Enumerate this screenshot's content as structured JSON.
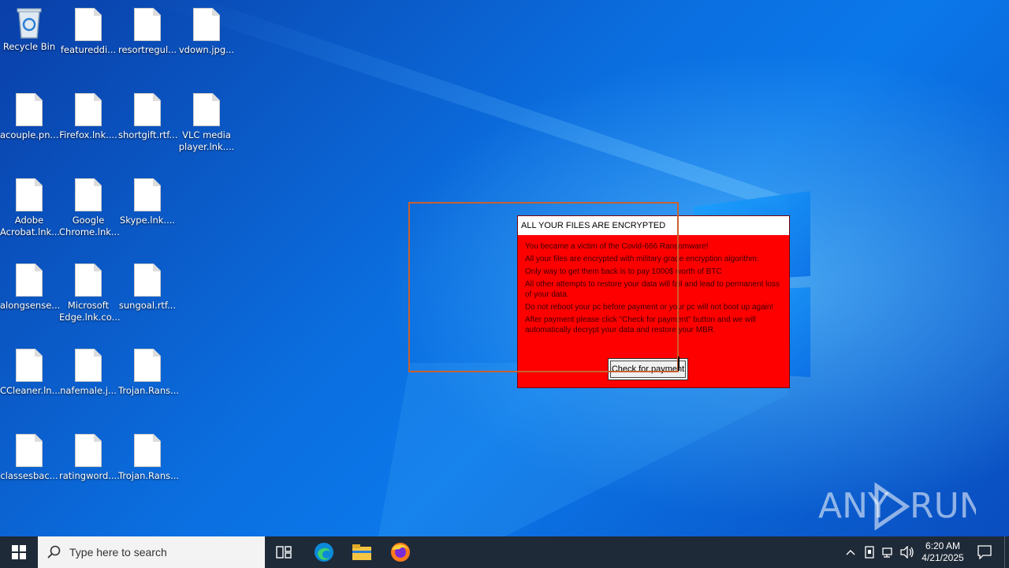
{
  "desktop": {
    "icons": [
      {
        "label": "Recycle Bin",
        "icon": "recycle-bin-icon"
      },
      {
        "label": "featureddi...",
        "icon": "file-icon"
      },
      {
        "label": "resortregul...",
        "icon": "file-icon"
      },
      {
        "label": "vdown.jpg...",
        "icon": "file-icon"
      },
      {
        "label": "acouple.pn...",
        "icon": "file-icon"
      },
      {
        "label": "Firefox.lnk....",
        "icon": "file-icon"
      },
      {
        "label": "shortgift.rtf...",
        "icon": "file-icon"
      },
      {
        "label": "VLC media player.lnk....",
        "icon": "file-icon"
      },
      {
        "label": "Adobe Acrobat.lnk...",
        "icon": "file-icon"
      },
      {
        "label": "Google Chrome.lnk...",
        "icon": "file-icon"
      },
      {
        "label": "Skype.lnk....",
        "icon": "file-icon"
      },
      {
        "label": "alongsense...",
        "icon": "file-icon"
      },
      {
        "label": "Microsoft Edge.lnk.co...",
        "icon": "file-icon"
      },
      {
        "label": "sungoal.rtf...",
        "icon": "file-icon"
      },
      {
        "label": "CCleaner.ln...",
        "icon": "file-icon"
      },
      {
        "label": "nafemale.j...",
        "icon": "file-icon"
      },
      {
        "label": "Trojan.Rans...",
        "icon": "file-icon"
      },
      {
        "label": "classesbac...",
        "icon": "file-icon"
      },
      {
        "label": "ratingword....",
        "icon": "file-icon"
      },
      {
        "label": "Trojan.Rans...",
        "icon": "file-icon"
      }
    ]
  },
  "ransom_window": {
    "title": "ALL YOUR FILES ARE ENCRYPTED",
    "lines": [
      "You became a victim of the Covid-666 Ransomware!",
      "All your files are encrypted with military grade encryption algorithm.",
      "Only way to get them back is to pay 1000$ worth of BTC",
      "All other attempts to restore your data will fail and lead to permanent loss of your data.",
      "Do not reboot your pc before payment or your pc will not boot up again!",
      "After payment please click \"Check for payment\" button and we will automatically decrypt your data and restore your MBR."
    ],
    "button_label": "Check for payment",
    "background_color": "#ff0000"
  },
  "watermark": {
    "text_left": "ANY",
    "text_right": "RUN"
  },
  "taskbar": {
    "search_placeholder": "Type here to search",
    "time": "6:20 AM",
    "date": "4/21/2025",
    "pinned": [
      "task-view-icon",
      "edge-icon",
      "file-explorer-icon",
      "firefox-icon"
    ],
    "tray": [
      "chevron-up-icon",
      "device-icon",
      "network-icon",
      "volume-icon"
    ]
  }
}
